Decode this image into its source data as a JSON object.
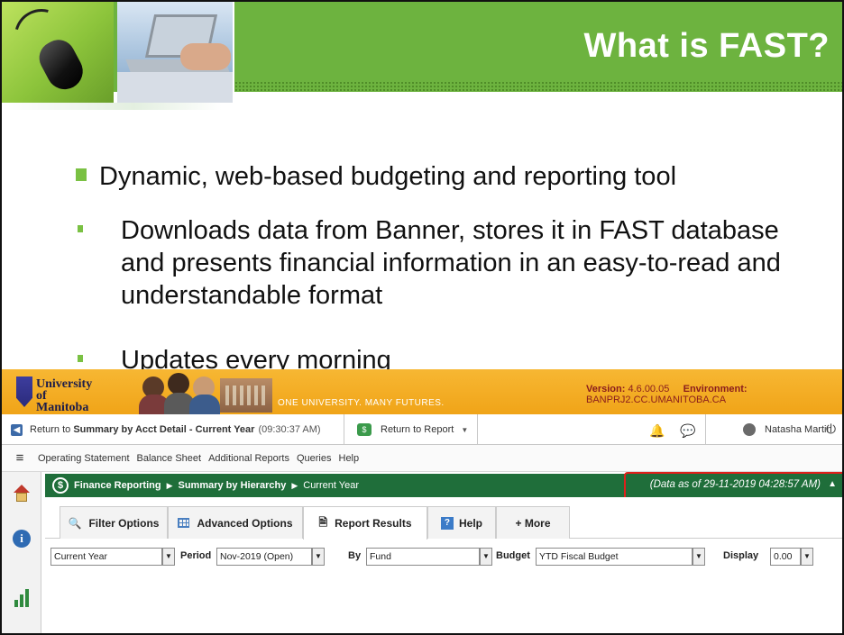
{
  "slide": {
    "title": "What is FAST?",
    "bullets": {
      "main": "Dynamic, web-based budgeting and reporting tool",
      "sub1": "Downloads data from Banner, stores it in FAST database and presents financial information in an easy-to-read and understandable format",
      "sub2": "Updates every morning"
    },
    "accent_color": "#6db33f"
  },
  "app": {
    "logo_line1": "University",
    "logo_line2": "of Manitoba",
    "tagline": "ONE UNIVERSITY. MANY FUTURES.",
    "version_label": "Version:",
    "version_value": "4.6.00.05",
    "environment_label": "Environment:",
    "environment_value": "BANPRJ2.CC.UMANITOBA.CA",
    "toolbar": {
      "return_prefix": "Return to",
      "return_target": "Summary by Acct Detail - Current Year",
      "return_time": "(09:30:37 AM)",
      "return_to_report": "Return to Report",
      "user_name": "Natasha Martin"
    },
    "menu": [
      "Operating Statement",
      "Balance Sheet",
      "Additional Reports",
      "Queries",
      "Help"
    ],
    "breadcrumb": {
      "root": "Finance Reporting",
      "level2": "Summary by Hierarchy",
      "level3": "Current Year",
      "data_as_of": "(Data as of 29-11-2019 04:28:57 AM)"
    },
    "tabs": [
      "Filter Options",
      "Advanced Options",
      "Report Results",
      "Help",
      "+ More"
    ],
    "active_tab": "Report Results",
    "filters": {
      "scope": "Current Year",
      "period_label": "Period",
      "period_value": "Nov-2019 (Open)",
      "by_label": "By",
      "by_value": "Fund",
      "budget_label": "Budget",
      "budget_value": "YTD Fiscal Budget",
      "display_label": "Display",
      "display_value": "0.00"
    },
    "colors": {
      "banner": "#f0a418",
      "finance_bar": "#1f6e3a",
      "highlight": "#e0201b"
    }
  }
}
